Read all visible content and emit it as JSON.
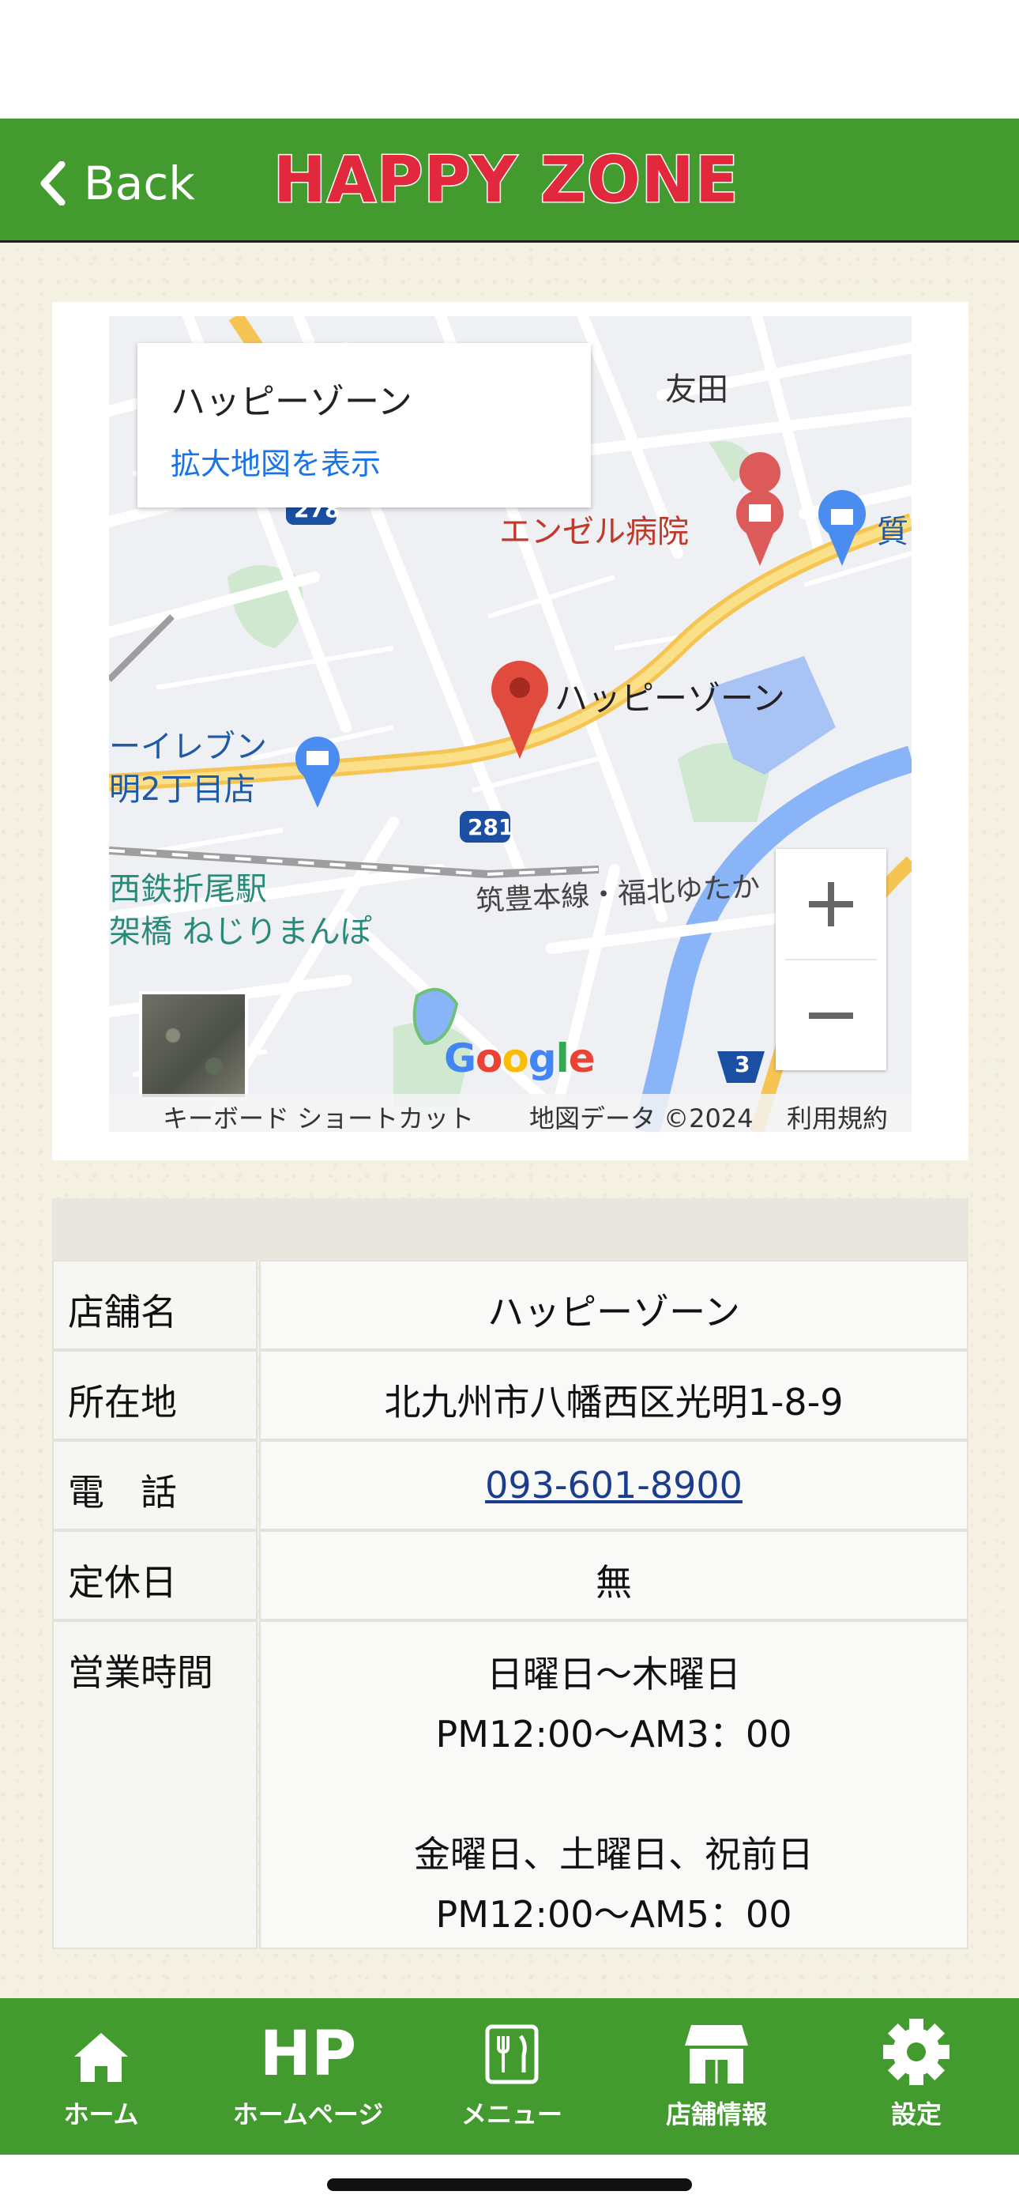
{
  "header": {
    "back_label": "Back",
    "logo_text": "HAPPY ZONE"
  },
  "map": {
    "info_window": {
      "title": "ハッピーゾーン",
      "link": "拡大地図を表示"
    },
    "labels": {
      "tomoda": "友田",
      "hospital": "エンゼル病院",
      "partial_right": "質",
      "marker": "ハッピーゾーン",
      "seven_eleven_1": "ーイレブン",
      "seven_eleven_2": "明2丁目店",
      "road_281": "281",
      "road_278": "278",
      "road_3": "3",
      "station_1": "西鉄折尾駅",
      "station_2": "架橋 ねじりまんぽ",
      "line": "筑豊本線・福北ゆたか",
      "google": "Google"
    },
    "attribution": {
      "shortcuts": "キーボード ショートカット",
      "data": "地図データ ©2024",
      "terms": "利用規約"
    }
  },
  "shop_info": {
    "rows": [
      {
        "label": "店舗名",
        "value": "ハッピーゾーン"
      },
      {
        "label": "所在地",
        "value": "北九州市八幡西区光明1-8-9"
      },
      {
        "label": "電　話",
        "value": "093-601-8900"
      },
      {
        "label": "定休日",
        "value": "無"
      },
      {
        "label": "営業時間",
        "lines": [
          "日曜日～木曜日",
          "PM12:00～AM3：00",
          "金曜日、土曜日、祝前日",
          "PM12:00～AM5：00"
        ]
      }
    ]
  },
  "tabbar": {
    "items": [
      {
        "label": "ホーム",
        "icon": "home-icon"
      },
      {
        "label": "ホームページ",
        "icon_text": "HP"
      },
      {
        "label": "メニュー",
        "icon": "menu-icon"
      },
      {
        "label": "店舗情報",
        "icon": "shop-icon"
      },
      {
        "label": "設定",
        "icon": "gear-icon"
      }
    ]
  },
  "colors": {
    "header_green": "#439b2f",
    "logo_red": "#e1283c",
    "link_blue": "#1a73e8",
    "tel_blue": "#1b3d8c"
  }
}
